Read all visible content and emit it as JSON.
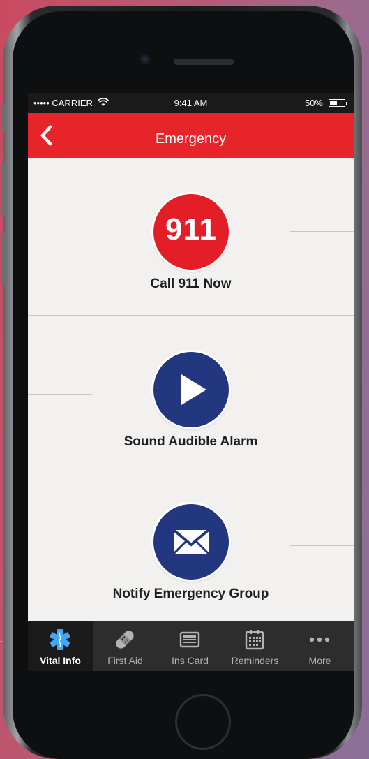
{
  "status_bar": {
    "carrier": "••••• CARRIER",
    "time": "9:41 AM",
    "battery_pct": "50%",
    "battery_level": 0.5
  },
  "header": {
    "title": "Emergency",
    "back_icon": "chevron-left-icon"
  },
  "actions": [
    {
      "label": "Call 911 Now",
      "icon_text": "911",
      "color": "#e31e27"
    },
    {
      "label": "Sound Audible Alarm",
      "icon": "play-icon",
      "color": "#233780"
    },
    {
      "label": "Notify Emergency Group",
      "icon": "envelope-icon",
      "color": "#233780"
    }
  ],
  "tabs": [
    {
      "label": "Vital Info",
      "icon": "star-of-life-icon",
      "active": true
    },
    {
      "label": "First Aid",
      "icon": "bandage-icon",
      "active": false
    },
    {
      "label": "Ins Card",
      "icon": "card-icon",
      "active": false
    },
    {
      "label": "Reminders",
      "icon": "calendar-icon",
      "active": false
    },
    {
      "label": "More",
      "icon": "more-dots-icon",
      "active": false
    }
  ],
  "colors": {
    "accent_red": "#e8242b",
    "accent_blue": "#233780",
    "tabbar": "#2d2d2d"
  }
}
